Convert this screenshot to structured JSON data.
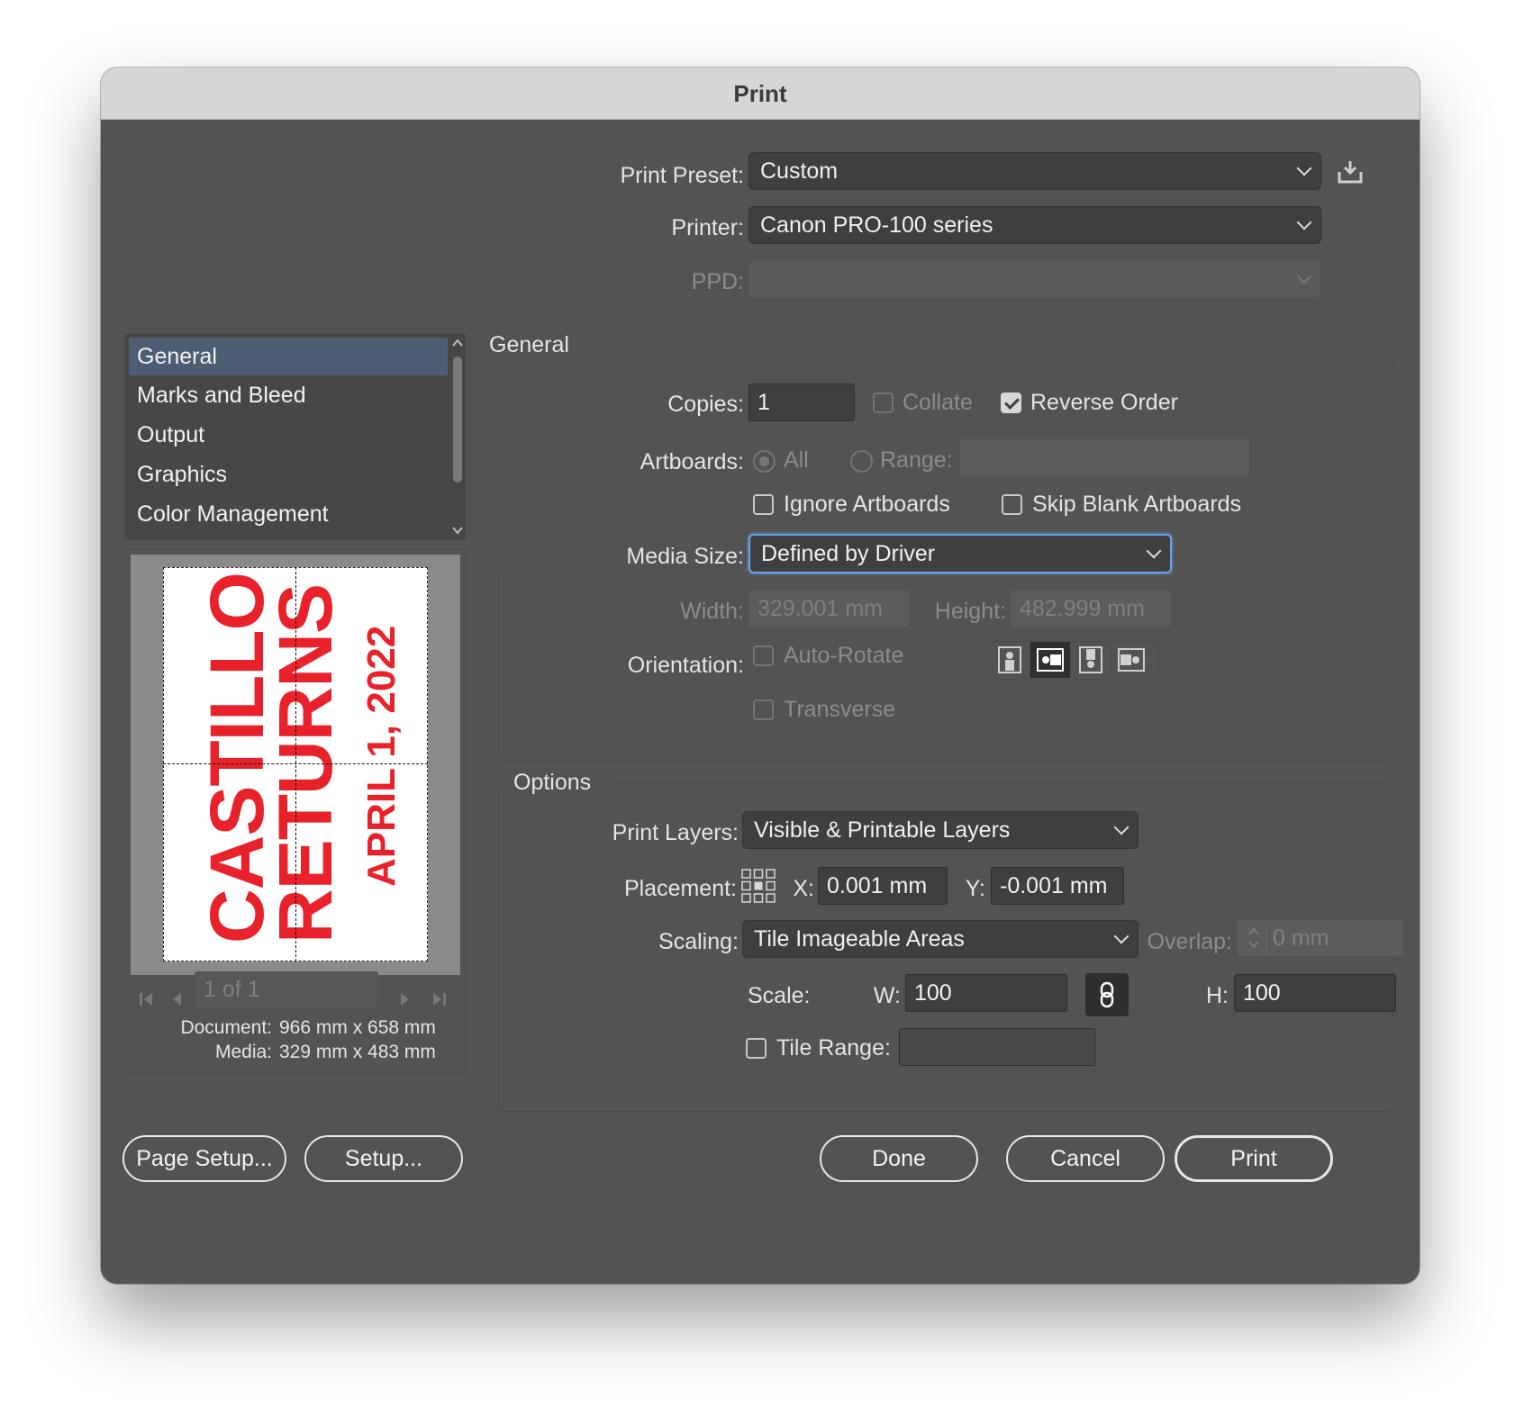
{
  "window": {
    "title": "Print"
  },
  "top": {
    "preset_label": "Print Preset:",
    "preset_value": "Custom",
    "printer_label": "Printer:",
    "printer_value": "Canon PRO-100 series",
    "ppd_label": "PPD:",
    "ppd_value": ""
  },
  "sidebar": {
    "items": [
      {
        "label": "General"
      },
      {
        "label": "Marks and Bleed"
      },
      {
        "label": "Output"
      },
      {
        "label": "Graphics"
      },
      {
        "label": "Color Management"
      }
    ]
  },
  "preview": {
    "poster_line1": "CASTILLO",
    "poster_line2": "RETURNS",
    "poster_line3": "APRIL 1, 2022",
    "pager": "1 of 1",
    "document_label": "Document:",
    "document_value": "966 mm x 658 mm",
    "media_label": "Media:",
    "media_value": "329 mm x 483 mm"
  },
  "general": {
    "heading": "General",
    "copies_label": "Copies:",
    "copies_value": "1",
    "collate_label": "Collate",
    "reverse_label": "Reverse Order",
    "artboards_label": "Artboards:",
    "all_label": "All",
    "range_label": "Range:",
    "range_value": "",
    "ignore_label": "Ignore Artboards",
    "skip_label": "Skip Blank Artboards",
    "media_size_label": "Media Size:",
    "media_size_value": "Defined by Driver",
    "width_label": "Width:",
    "width_value": "329.001 mm",
    "height_label": "Height:",
    "height_value": "482.999 mm",
    "orientation_label": "Orientation:",
    "autorotate_label": "Auto-Rotate",
    "transverse_label": "Transverse"
  },
  "options": {
    "heading": "Options",
    "layers_label": "Print Layers:",
    "layers_value": "Visible & Printable Layers",
    "placement_label": "Placement:",
    "x_label": "X:",
    "x_value": "0.001 mm",
    "y_label": "Y:",
    "y_value": "-0.001 mm",
    "scaling_label": "Scaling:",
    "scaling_value": "Tile Imageable Areas",
    "overlap_label": "Overlap:",
    "overlap_value": "0 mm",
    "scale_label": "Scale:",
    "w_label": "W:",
    "w_value": "100",
    "h_label": "H:",
    "h_value": "100",
    "tile_range_label": "Tile Range:",
    "tile_range_value": ""
  },
  "buttons": {
    "page_setup": "Page Setup...",
    "setup": "Setup...",
    "done": "Done",
    "cancel": "Cancel",
    "print": "Print"
  },
  "colors": {
    "window_bg": "#535353",
    "selection": "#4e5e72",
    "poster_red": "#e8212b",
    "focus_blue": "#6aa1e6"
  }
}
